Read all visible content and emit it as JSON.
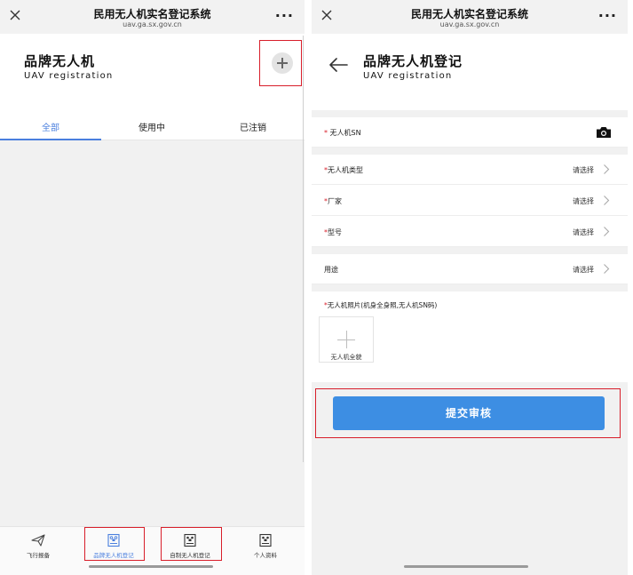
{
  "browser": {
    "title": "民用无人机实名登记系统",
    "url": "uav.ga.sx.gov.cn"
  },
  "list_page": {
    "title": "品牌无人机",
    "subtitle": "UAV registration",
    "tabs": [
      {
        "label": "全部",
        "active": true
      },
      {
        "label": "使用中",
        "active": false
      },
      {
        "label": "已注销",
        "active": false
      }
    ],
    "bottom_nav": [
      {
        "label": "飞行报备",
        "icon": "paper-plane-icon",
        "active": false
      },
      {
        "label": "品牌无人机登记",
        "icon": "drone-document-icon",
        "active": true
      },
      {
        "label": "自制无人机登记",
        "icon": "drone-document-icon",
        "active": false
      },
      {
        "label": "个人资料",
        "icon": "profile-document-icon",
        "active": false
      }
    ]
  },
  "form_page": {
    "title": "品牌无人机登记",
    "subtitle": "UAV registration",
    "fields": {
      "sn": {
        "star": "*",
        "label": " 无人机SN"
      },
      "type": {
        "star": "*",
        "label": "无人机类型",
        "value": "请选择"
      },
      "vendor": {
        "star": "*",
        "label": "厂家",
        "value": "请选择"
      },
      "model": {
        "star": "*",
        "label": "型号",
        "value": "请选择"
      },
      "usage": {
        "label": "用途",
        "value": "请选择"
      }
    },
    "photo": {
      "star": "*",
      "label": "无人机照片(机身全身照,无人机SN码)",
      "caption": "无人机全貌"
    },
    "submit_label": "提交审核"
  },
  "colors": {
    "accent": "#4a7fde",
    "button": "#3d8ee3",
    "highlight_border": "#d81e2a",
    "required_star": "#d81e2a"
  }
}
